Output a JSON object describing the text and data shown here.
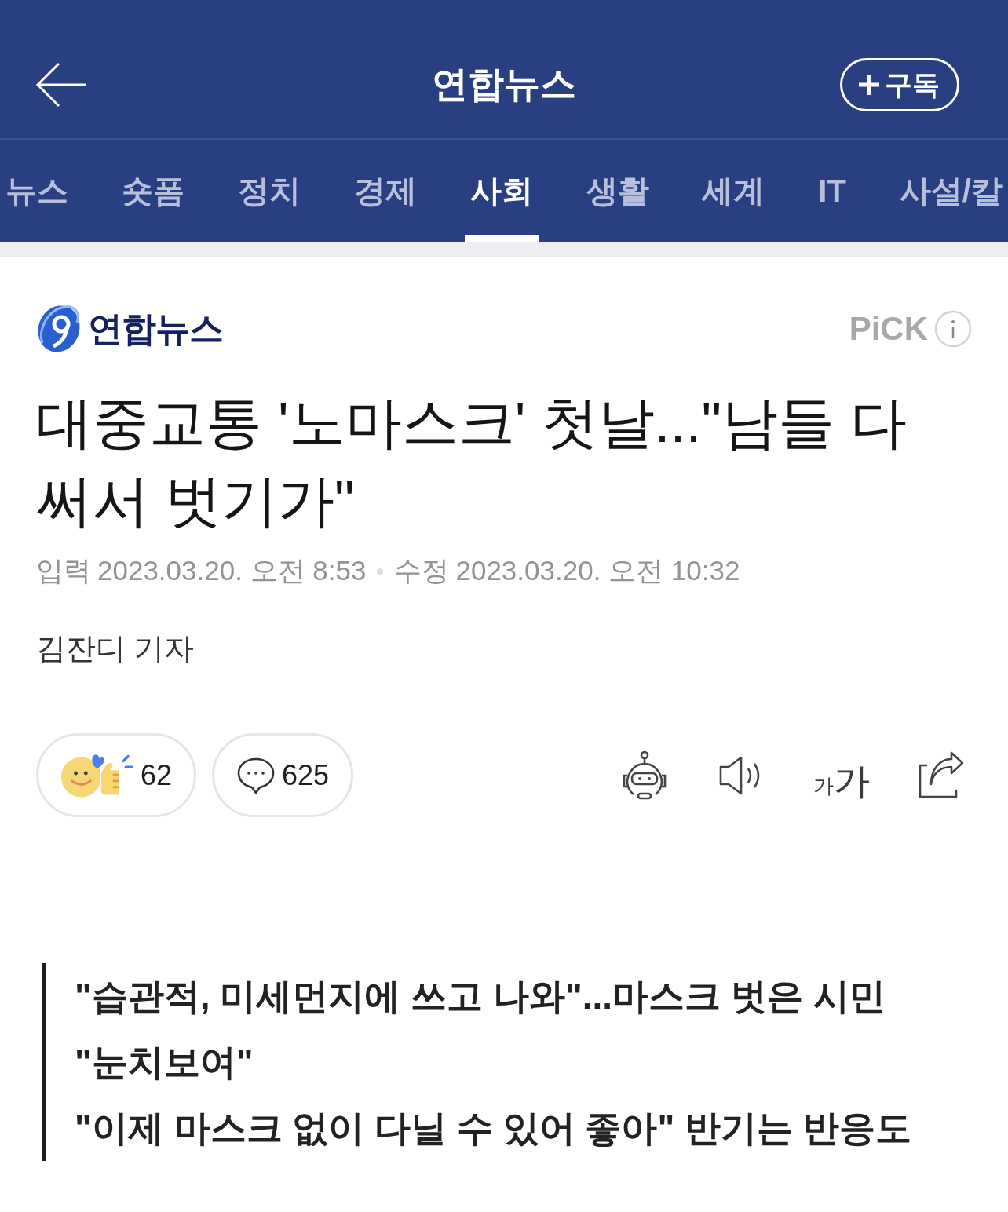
{
  "header": {
    "title": "연합뉴스",
    "subscribe_button": "구독"
  },
  "tabs": [
    {
      "label": "뉴스",
      "selected": false
    },
    {
      "label": "숏폼",
      "selected": false
    },
    {
      "label": "정치",
      "selected": false
    },
    {
      "label": "경제",
      "selected": false
    },
    {
      "label": "사회",
      "selected": true
    },
    {
      "label": "생활",
      "selected": false
    },
    {
      "label": "세계",
      "selected": false
    },
    {
      "label": "IT",
      "selected": false
    },
    {
      "label": "사설/칼",
      "selected": false
    }
  ],
  "article": {
    "press_name": "연합뉴스",
    "pick_label": "PiCK",
    "headline": "대중교통 '노마스크' 첫날...\"남들 다 써서 벗기가\"",
    "published_label": "입력",
    "published": "2023.03.20. 오전 8:53",
    "modified_label": "수정",
    "modified": "2023.03.20. 오전 10:32",
    "reporter": "김잔디 기자"
  },
  "actions": {
    "reactions": "62",
    "comments": "625",
    "font_size_small": "가",
    "font_size_large": "가"
  },
  "summary": [
    "\"습관적, 미세먼지에 쓰고 나와\"...마스크 벗은 시민 \"눈치보여\"",
    "\"이제 마스크 없이 다닐 수 있어 좋아\" 반기는 반응도"
  ]
}
